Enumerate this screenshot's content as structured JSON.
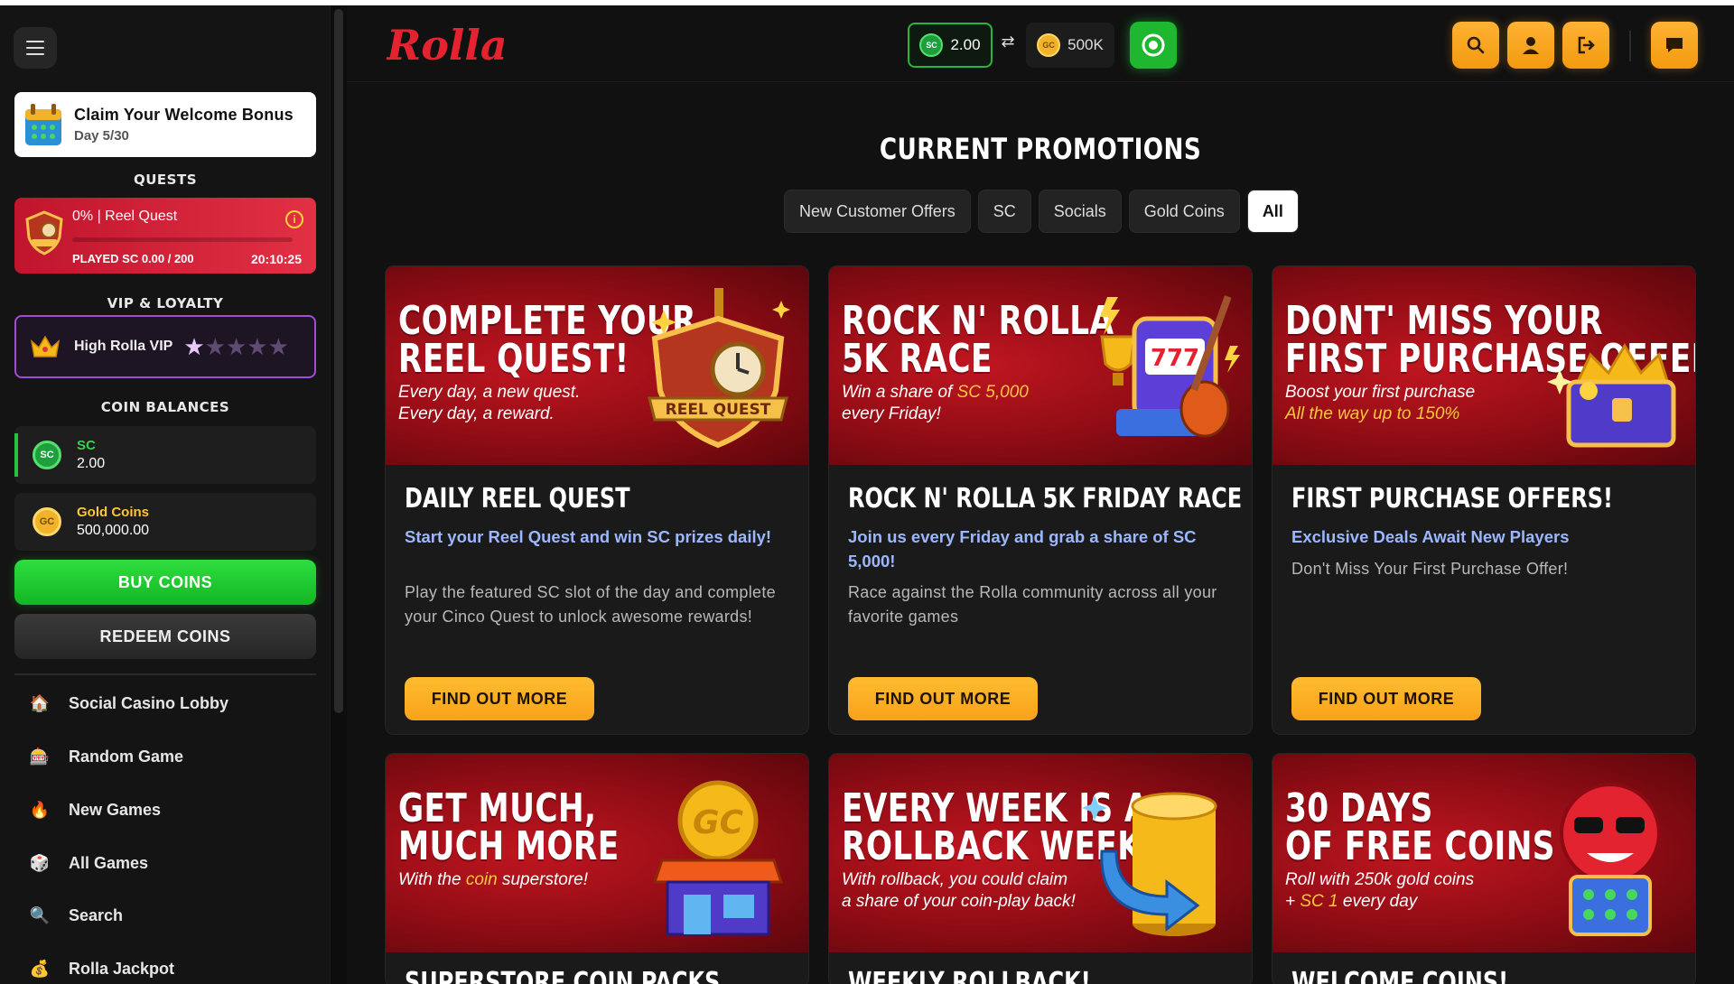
{
  "sidebar": {
    "welcome": {
      "title": "Claim Your Welcome Bonus",
      "day": "Day 5/30"
    },
    "quests_title": "QUESTS",
    "quest": {
      "title": "0%  |  Reel Quest",
      "played": "PLAYED SC 0.00 / 200",
      "timer": "20:10:25",
      "progress": 0
    },
    "vip_title": "VIP & LOYALTY",
    "vip": {
      "label": "High Rolla VIP",
      "stars_filled": 1,
      "stars_total": 5
    },
    "balances_title": "COIN BALANCES",
    "sc": {
      "name": "SC",
      "value": "2.00",
      "badge": "SC"
    },
    "gc": {
      "name": "Gold Coins",
      "value": "500,000.00",
      "badge": "GC"
    },
    "buy_label": "BUY COINS",
    "redeem_label": "REDEEM COINS",
    "nav": [
      {
        "label": "Social Casino Lobby",
        "icon": "house-icon"
      },
      {
        "label": "Random Game",
        "icon": "slot-machine-icon"
      },
      {
        "label": "New Games",
        "icon": "flame-icon"
      },
      {
        "label": "All Games",
        "icon": "dice-icon"
      },
      {
        "label": "Search",
        "icon": "magnifier-icon"
      },
      {
        "label": "Rolla Jackpot",
        "icon": "money-bag-icon"
      }
    ]
  },
  "topbar": {
    "logo": "Rolla",
    "sc_balance": "2.00",
    "sc_badge": "SC",
    "gc_balance": "500K",
    "gc_badge": "GC",
    "swap": "⇄"
  },
  "main": {
    "title": "CURRENT PROMOTIONS",
    "filters": [
      "New Customer Offers",
      "SC",
      "Socials",
      "Gold Coins",
      "All"
    ],
    "active_filter": "All",
    "cards": [
      {
        "banner_heading_1": "COMPLETE YOUR",
        "banner_heading_2": "REEL QUEST!",
        "banner_sub_1": "Every day, a new quest.",
        "banner_sub_2": "Every day, a reward.",
        "banner_badge": "REEL QUEST",
        "title": "DAILY REEL QUEST",
        "subtitle": "Start your Reel Quest and win SC prizes daily!",
        "desc": "Play the featured SC slot of the day and complete your Cinco Quest to unlock awesome rewards!",
        "button": "FIND OUT MORE"
      },
      {
        "banner_heading_1": "ROCK N' ROLLA",
        "banner_heading_2": "5K RACE",
        "banner_sub_1_pre": "Win a share of ",
        "banner_sub_1_hl": "SC 5,000",
        "banner_sub_2": "every Friday!",
        "title": "ROCK N' ROLLA 5K FRIDAY RACE",
        "subtitle": "Join us every Friday and grab a share of SC 5,000!",
        "desc": "Race against the Rolla community across all your favorite games",
        "button": "FIND OUT MORE"
      },
      {
        "banner_heading_1": "DONT' MISS YOUR",
        "banner_heading_2": "FIRST PURCHASE OFFER",
        "banner_sub_1": "Boost your first purchase",
        "banner_sub_2": "All the way up to 150%",
        "title": "FIRST PURCHASE OFFERS!",
        "subtitle": "Exclusive Deals Await New Players",
        "desc": "Don't Miss Your First Purchase Offer!",
        "button": "FIND OUT MORE"
      }
    ],
    "cards_row2": [
      {
        "banner_heading_1": "GET MUCH,",
        "banner_heading_2": "MUCH MORE",
        "banner_sub_pre": "With the ",
        "banner_sub_hl": "coin",
        "banner_sub_post": " superstore!",
        "title": "SUPERSTORE COIN PACKS"
      },
      {
        "banner_heading_1": "EVERY WEEK IS A",
        "banner_heading_2": "ROLLBACK WEEK",
        "banner_sub_1": "With rollback, you could claim",
        "banner_sub_2": "a share of your coin-play back!",
        "title": "WEEKLY ROLLBACK!"
      },
      {
        "banner_heading_1": "30 DAYS",
        "banner_heading_2": "OF FREE COINS",
        "banner_sub_1": "Roll with 250k gold coins",
        "banner_sub_2_pre": "+ ",
        "banner_sub_2_hl": "SC 1",
        "banner_sub_2_post": " every day",
        "title": "WELCOME COINS!"
      }
    ]
  },
  "colors": {
    "brand_red": "#e3232f",
    "accent_orange": "#f7a21a",
    "sc_green": "#1fb630",
    "link_blue": "#9bb7ff",
    "vip_purple": "#a14bd6"
  }
}
